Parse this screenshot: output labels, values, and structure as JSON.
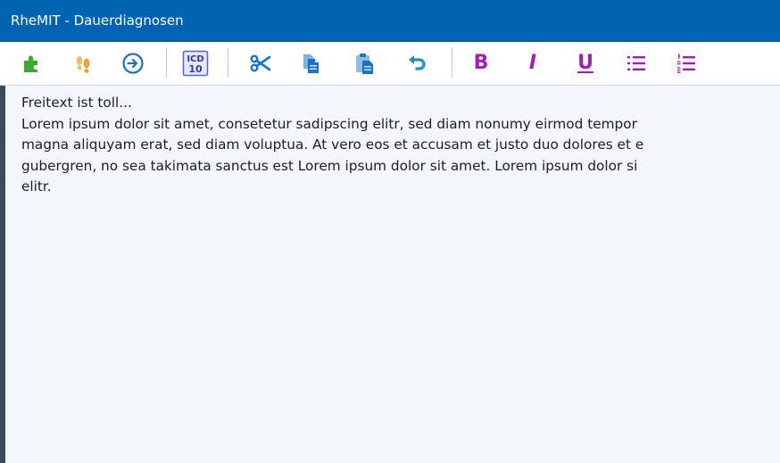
{
  "window": {
    "title": "RheMIT - Dauerdiagnosen"
  },
  "toolbar": {
    "buttons": [
      {
        "name": "puzzle-icon"
      },
      {
        "name": "footprints-icon"
      },
      {
        "name": "arrow-right-circle-icon"
      },
      {
        "name": "icd10-icon",
        "label_top": "ICD",
        "label_bottom": "10"
      },
      {
        "name": "scissors-icon"
      },
      {
        "name": "copy-icon"
      },
      {
        "name": "paste-icon"
      },
      {
        "name": "undo-icon"
      },
      {
        "name": "bold-icon",
        "label": "B"
      },
      {
        "name": "italic-icon",
        "label": "I"
      },
      {
        "name": "underline-icon",
        "label": "U"
      },
      {
        "name": "bullet-list-icon"
      },
      {
        "name": "numbered-list-icon"
      }
    ]
  },
  "editor": {
    "lines": [
      "Freitext ist toll...",
      "Lorem ipsum dolor sit amet, consetetur sadipscing elitr, sed diam nonumy eirmod tempor",
      "magna aliquyam erat, sed diam voluptua. At vero eos et accusam et justo duo dolores et e",
      "gubergren, no sea takimata sanctus est Lorem ipsum dolor sit amet. Lorem ipsum dolor si",
      "elitr."
    ]
  },
  "colors": {
    "titlebar": "#0063b1",
    "format_accent": "#a01fb0",
    "icon_blue": "#1a72c4",
    "icon_green": "#3fa535",
    "icon_orange": "#f0a030"
  }
}
